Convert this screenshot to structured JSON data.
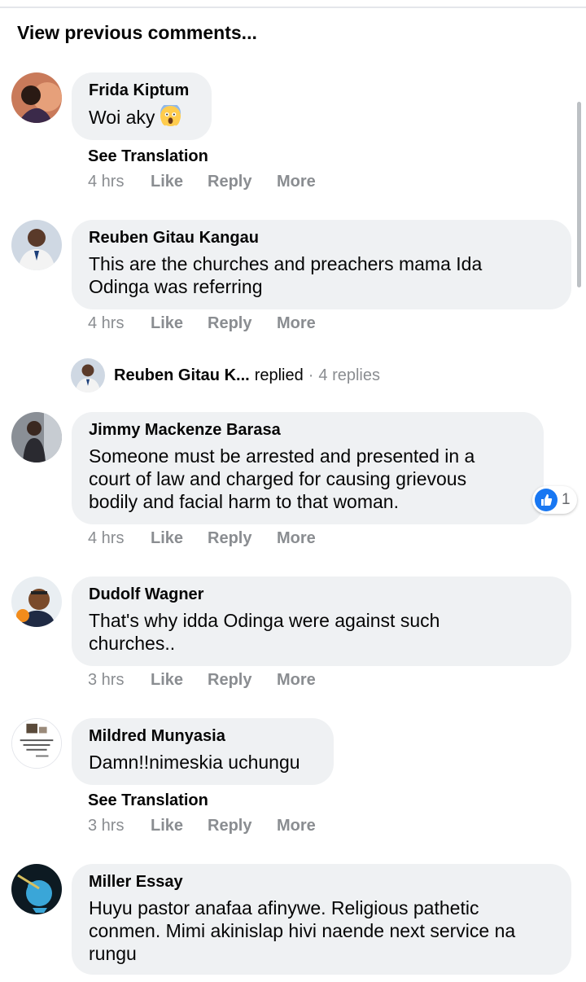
{
  "header": {
    "view_previous": "View previous comments..."
  },
  "actions": {
    "like": "Like",
    "reply": "Reply",
    "more": "More",
    "see_translation": "See Translation"
  },
  "comments": [
    {
      "author": "Frida Kiptum",
      "text": "Woi aky",
      "emoji": "face-screaming-in-fear",
      "time": "4 hrs",
      "see_translation": true
    },
    {
      "author": "Reuben Gitau Kangau",
      "text_lines": [
        "This are the churches and preachers mama Ida",
        "Odinga was referring"
      ],
      "time": "4 hrs"
    },
    {
      "author": "Jimmy Mackenze Barasa",
      "text_lines": [
        "Someone must be arrested and presented in a",
        "court of law and charged for causing grievous",
        "bodily and facial harm to that woman."
      ],
      "time": "4 hrs",
      "reaction": {
        "icon": "thumbs-up-icon",
        "count": "1",
        "color": "#1877f2"
      }
    },
    {
      "author": "Dudolf Wagner",
      "text_lines": [
        "That's why idda Odinga were against such",
        "churches.."
      ],
      "time": "3 hrs"
    },
    {
      "author": "Mildred Munyasia",
      "text": "Damn!!nimeskia uchungu",
      "time": "3 hrs",
      "see_translation": true
    },
    {
      "author": "Miller Essay",
      "text_lines": [
        "Huyu pastor anafaa afinywe. Religious pathetic",
        "conmen. Mimi akinislap hivi naende next service na",
        "rungu"
      ]
    }
  ],
  "replies_summary": {
    "name": "Reuben Gitau K...",
    "verb": "replied",
    "separator": "·",
    "count": "4 replies"
  },
  "colors": {
    "bubble": "#eff1f3",
    "meta": "#8a8d91",
    "like_blue": "#1877f2"
  }
}
